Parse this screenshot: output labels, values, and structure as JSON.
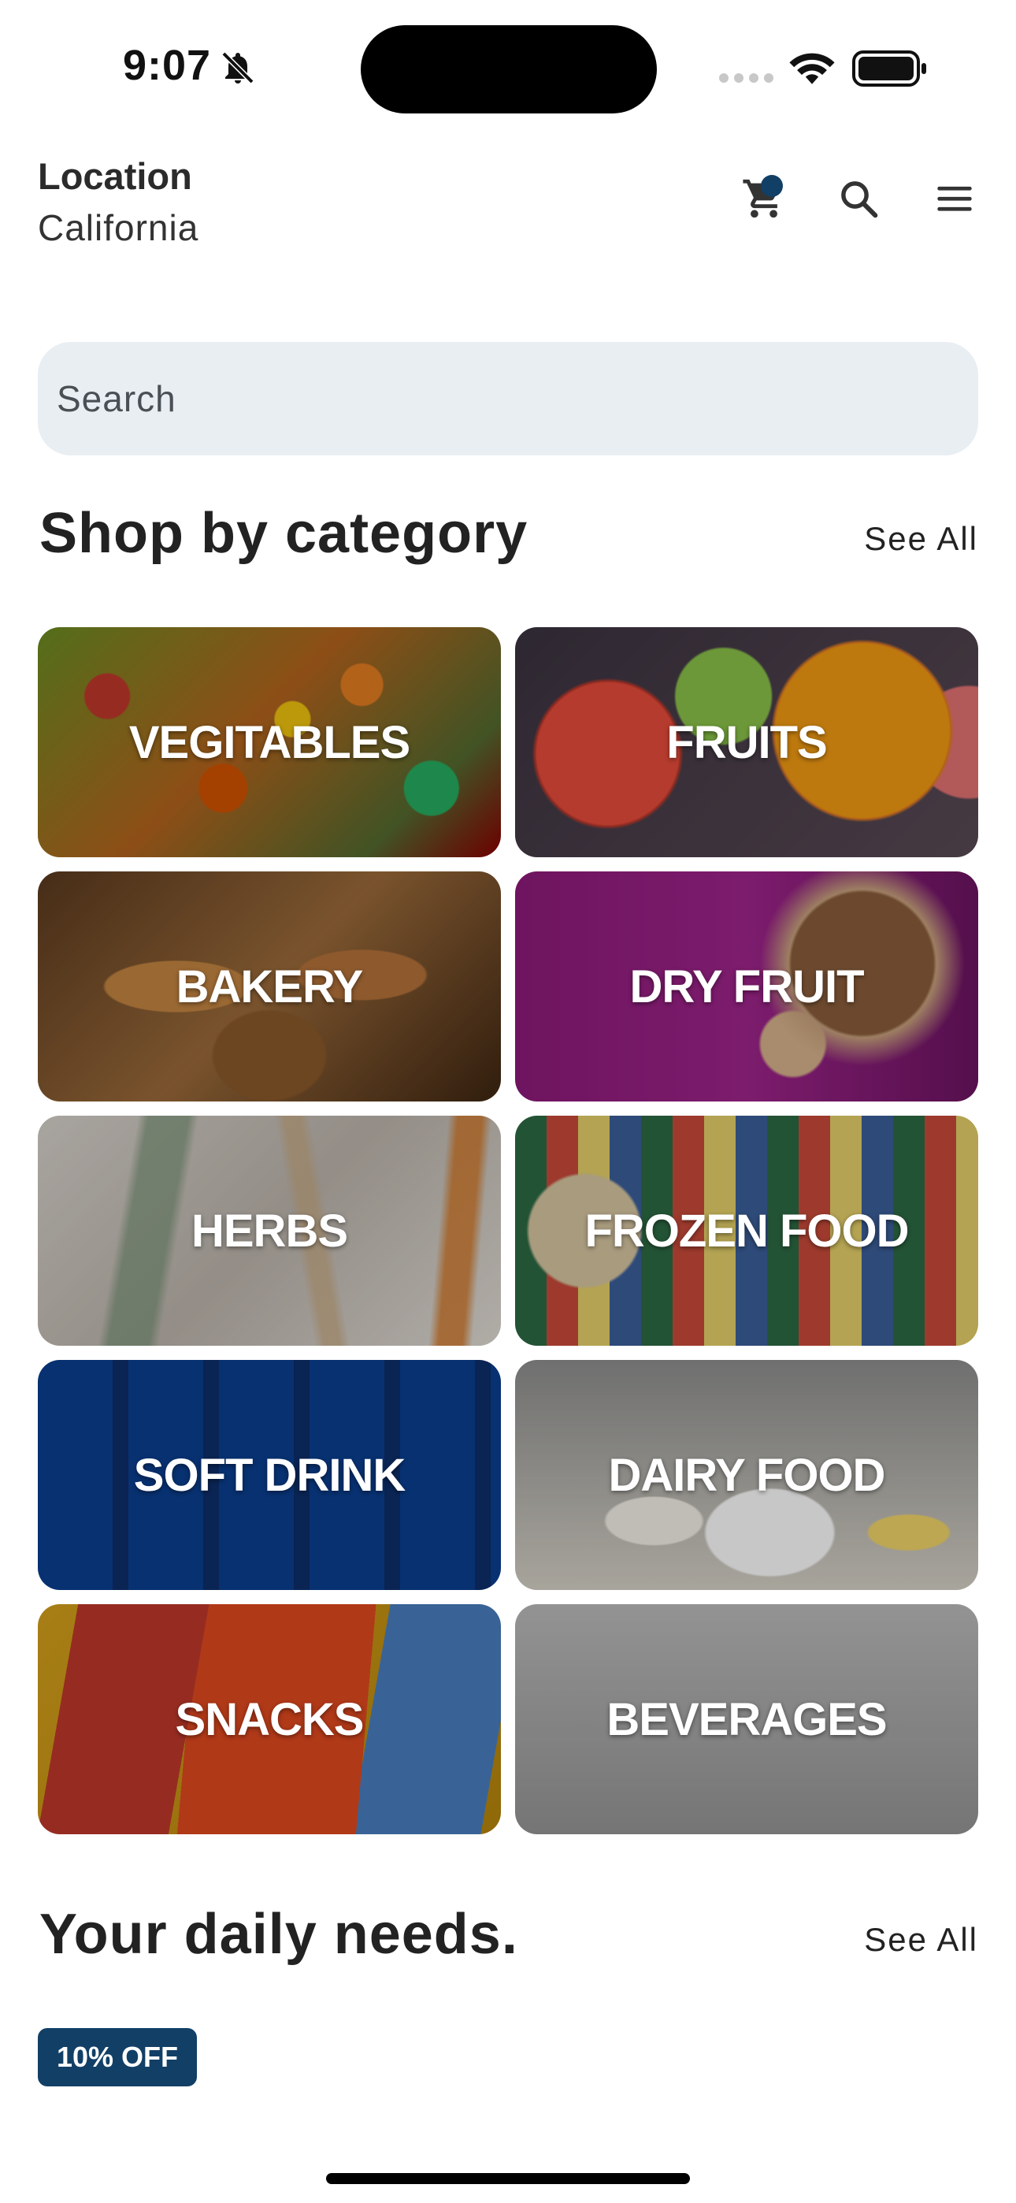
{
  "status_bar": {
    "time": "9:07"
  },
  "header": {
    "location_title": "Location",
    "location_value": "California",
    "icons": [
      "cart-icon",
      "search-icon",
      "menu-icon"
    ],
    "accent_color": "#123f66"
  },
  "search": {
    "placeholder": "Search"
  },
  "categories_section": {
    "title": "Shop by category",
    "see_all": "See All",
    "items": [
      {
        "label": "VEGITABLES"
      },
      {
        "label": "FRUITS"
      },
      {
        "label": "BAKERY"
      },
      {
        "label": "DRY FRUIT"
      },
      {
        "label": "HERBS"
      },
      {
        "label": "FROZEN FOOD"
      },
      {
        "label": "SOFT DRINK"
      },
      {
        "label": "DAIRY FOOD"
      },
      {
        "label": "SNACKS"
      },
      {
        "label": "BEVERAGES"
      }
    ]
  },
  "daily_section": {
    "title": "Your daily needs.",
    "see_all": "See All",
    "badge": "10% OFF"
  }
}
